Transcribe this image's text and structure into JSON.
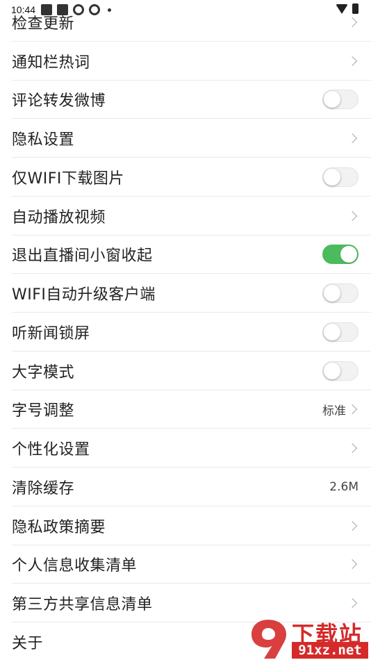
{
  "status_bar": {
    "time": "10:44"
  },
  "items": [
    {
      "label": "检查更新",
      "control": "chevron"
    },
    {
      "label": "通知栏热词",
      "control": "chevron"
    },
    {
      "label": "评论转发微博",
      "control": "toggle",
      "on": false
    },
    {
      "label": "隐私设置",
      "control": "chevron"
    },
    {
      "label": "仅WIFI下载图片",
      "control": "toggle",
      "on": false
    },
    {
      "label": "自动播放视频",
      "control": "chevron"
    },
    {
      "label": "退出直播间小窗收起",
      "control": "toggle",
      "on": true
    },
    {
      "label": "WIFI自动升级客户端",
      "control": "toggle",
      "on": false
    },
    {
      "label": "听新闻锁屏",
      "control": "toggle",
      "on": false
    },
    {
      "label": "大字模式",
      "control": "toggle",
      "on": false
    },
    {
      "label": "字号调整",
      "control": "chevron",
      "value": "标准"
    },
    {
      "label": "个性化设置",
      "control": "chevron"
    },
    {
      "label": "清除缓存",
      "control": "value",
      "value": "2.6M"
    },
    {
      "label": "隐私政策摘要",
      "control": "chevron"
    },
    {
      "label": "个人信息收集清单",
      "control": "chevron"
    },
    {
      "label": "第三方共享信息清单",
      "control": "chevron"
    },
    {
      "label": "关于",
      "control": "none"
    }
  ],
  "watermark": {
    "top_text": "下载站",
    "bottom_text": "91xz.net",
    "accent": "#d52a2a"
  },
  "colors": {
    "toggle_on": "#4cbb5b"
  }
}
